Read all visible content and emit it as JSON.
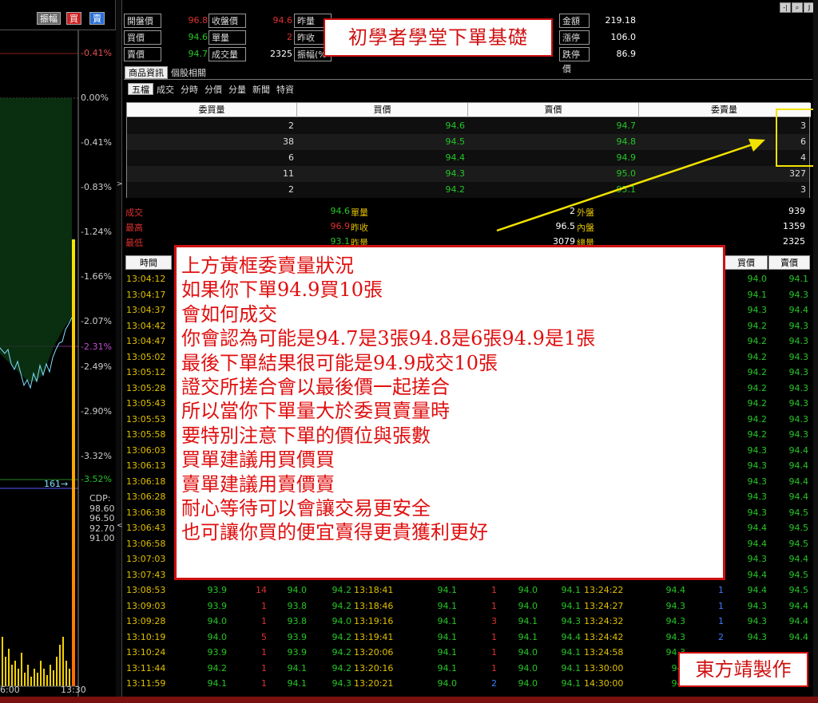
{
  "toolbar": {
    "btn_amp": "振幅",
    "btn_buy": "買",
    "btn_sell": "賣"
  },
  "chart": {
    "pct_labels": [
      "-0.41%",
      "0.00%",
      "-0.41%",
      "-0.83%",
      "-1.24%",
      "-1.66%",
      "-2.07%",
      "-2.31%",
      "-2.49%",
      "-2.90%",
      "-3.32%",
      "-3.52%"
    ],
    "marker": "161→",
    "cdp": {
      "label": "CDP:",
      "values": [
        "98.60",
        "96.50",
        "92.70",
        "91.00"
      ]
    },
    "time_start": "6:00",
    "time_end": "13:30",
    "collapse_right": ">",
    "collapse_left": "<"
  },
  "quote": {
    "row1": {
      "l1": "開盤價",
      "v1": "96.8",
      "l2": "收盤價",
      "v2": "94.6",
      "l3": "昨量"
    },
    "row2": {
      "l1": "買價",
      "v1": "94.6",
      "l2": "單量",
      "v2": "2",
      "l3": "昨收"
    },
    "row3": {
      "l1": "賣價",
      "v1": "94.7",
      "l2": "成交量",
      "v2": "2325",
      "l3": "振幅(%"
    },
    "right": {
      "l1": "金額",
      "v1": "219.18",
      "l2": "漲停價",
      "v2": "106.0",
      "l3": "跌停價",
      "v3": "86.9"
    }
  },
  "tabs1": {
    "t1": "商品資訊",
    "t2": "個股相關"
  },
  "tabs2": {
    "t1": "五檔",
    "t2": "成交",
    "t3": "分時",
    "t4": "分價",
    "t5": "分量",
    "t6": "新聞",
    "t7": "特資"
  },
  "book": {
    "headers": {
      "bid_qty": "委買量",
      "bid": "買價",
      "ask": "賣價",
      "ask_qty": "委賣量"
    },
    "rows": [
      {
        "bid_qty": "2",
        "bid": "94.6",
        "ask": "94.7",
        "ask_qty": "3"
      },
      {
        "bid_qty": "38",
        "bid": "94.5",
        "ask": "94.8",
        "ask_qty": "6"
      },
      {
        "bid_qty": "6",
        "bid": "94.4",
        "ask": "94.9",
        "ask_qty": "4"
      },
      {
        "bid_qty": "11",
        "bid": "94.3",
        "ask": "95.0",
        "ask_qty": "327"
      },
      {
        "bid_qty": "2",
        "bid": "94.2",
        "ask": "95.1",
        "ask_qty": "3"
      }
    ]
  },
  "summary": {
    "deal_label": "成交",
    "deal": "94.6",
    "unit_label": "單量",
    "unit": "2",
    "outer_label": "外盤",
    "outer": "939",
    "high_label": "最高",
    "high": "96.9",
    "prevclose_label": "昨收",
    "prevclose": "96.5",
    "inner_label": "內盤",
    "inner": "1359",
    "low_label": "最低",
    "low": "93.1",
    "prevvol_label": "昨量",
    "prevvol": "3079",
    "total_label": "總量",
    "total": "2325"
  },
  "trades": {
    "headers": {
      "time": "時間",
      "bid": "買價",
      "ask": "賣價"
    },
    "left_times": [
      "13:04:12",
      "13:04:17",
      "13:04:37",
      "13:04:42",
      "13:04:47",
      "13:05:02",
      "13:05:12",
      "13:05:28",
      "13:05:43",
      "13:05:53",
      "13:05:58",
      "13:06:03",
      "13:06:13",
      "13:06:18",
      "13:06:28",
      "13:06:38",
      "13:06:43",
      "13:06:58",
      "13:07:03",
      "13:07:43"
    ],
    "right_bid": [
      "94.0",
      "94.1",
      "94.3",
      "94.2",
      "94.2",
      "94.2",
      "94.2",
      "94.2",
      "94.2",
      "94.2",
      "94.2",
      "94.3",
      "94.3",
      "94.3",
      "94.3",
      "94.3",
      "94.4",
      "94.4",
      "94.3",
      "94.4"
    ],
    "right_ask": [
      "94.1",
      "94.3",
      "94.4",
      "94.3",
      "94.3",
      "94.3",
      "94.3",
      "94.3",
      "94.3",
      "94.3",
      "94.3",
      "94.4",
      "94.4",
      "94.4",
      "94.4",
      "94.5",
      "94.5",
      "94.5",
      "94.4",
      "94.5"
    ],
    "bottom_rows": [
      [
        "13:08:53",
        "93.9",
        "14",
        "94.0",
        "94.2",
        "13:18:41",
        "94.1",
        "1",
        "94.0",
        "94.1",
        "13:24:22",
        "94.4",
        "1",
        "94.4",
        "94.5"
      ],
      [
        "13:09:03",
        "93.9",
        "1",
        "93.8",
        "94.2",
        "13:18:46",
        "94.1",
        "1",
        "94.0",
        "94.1",
        "13:24:27",
        "94.3",
        "1",
        "94.3",
        "94.4"
      ],
      [
        "13:09:28",
        "94.0",
        "1",
        "93.8",
        "94.0",
        "13:19:16",
        "94.1",
        "3",
        "94.1",
        "94.3",
        "13:24:32",
        "94.3",
        "1",
        "94.3",
        "94.4"
      ],
      [
        "13:10:19",
        "94.0",
        "5",
        "93.9",
        "94.2",
        "13:19:41",
        "94.1",
        "1",
        "94.1",
        "94.4",
        "13:24:42",
        "94.3",
        "2",
        "94.3",
        "94.4"
      ],
      [
        "13:10:24",
        "93.9",
        "1",
        "93.9",
        "94.2",
        "13:20:06",
        "94.1",
        "1",
        "94.0",
        "94.1",
        "13:24:58",
        "94.3",
        "",
        "",
        ""
      ],
      [
        "13:11:44",
        "94.2",
        "1",
        "94.1",
        "94.2",
        "13:20:16",
        "94.1",
        "1",
        "94.0",
        "94.1",
        "13:30:00",
        "94.",
        "",
        "",
        ""
      ],
      [
        "13:11:59",
        "94.1",
        "1",
        "94.1",
        "94.3",
        "13:20:21",
        "94.0",
        "2",
        "94.0",
        "94.1",
        "14:30:00",
        "94.",
        "",
        "",
        ""
      ]
    ]
  },
  "overlay": {
    "title": "初學者學堂下單基礎",
    "note": [
      "上方黃框委賣量狀況",
      "如果你下單94.9買10張",
      "會如何成交",
      "你會認為可能是94.7是3張94.8是6張94.9是1張",
      "最後下單結果很可能是94.9成交10張",
      "證交所搓合會以最後價一起搓合",
      "所以當你下單量大於委買賣量時",
      "要特別注意下單的價位與張數",
      "買單建議用買價買",
      "賣單建議用賣價賣",
      "耐心等待可以會讓交易更安全",
      "也可讓你買的便宜賣得更貴獲利更好"
    ],
    "credit": "東方靖製作"
  },
  "window_tools": {
    "t1": "-|",
    "t2": "⌕",
    "t3": "J"
  },
  "colors": {
    "up": "#e03030",
    "down": "#25c625",
    "neutral": "#dddddd",
    "accent_yellow": "#f2e200",
    "note_red": "#d01010"
  }
}
